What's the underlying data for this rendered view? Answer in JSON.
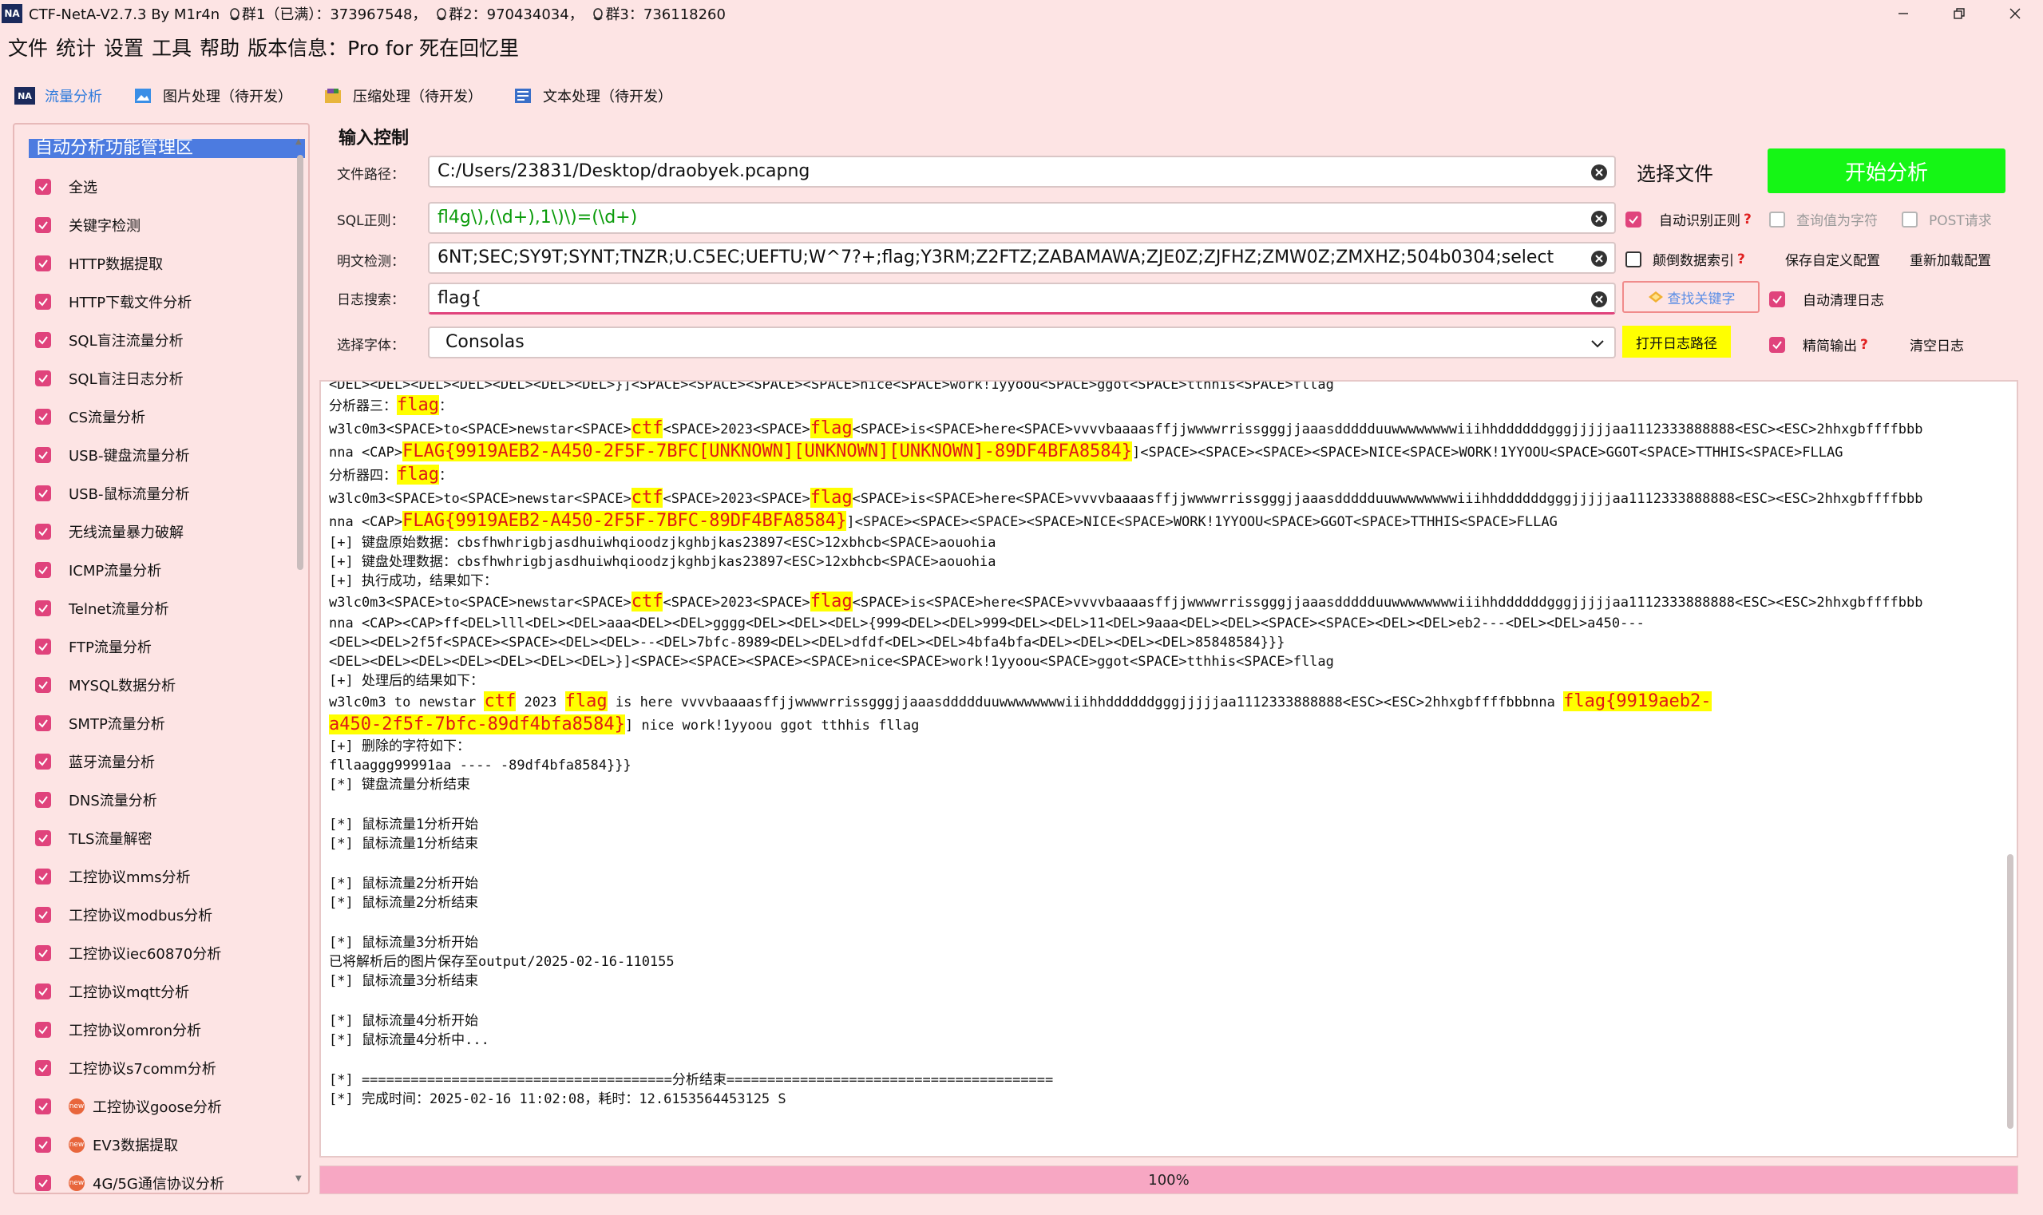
{
  "window": {
    "title_prefix": "CTF-NetA-V2.7.3 By M1r4n",
    "group1": "群1（已满）：373967548，",
    "group2": "群2：970434034，",
    "group3": "群3：736118260",
    "logo": "NA"
  },
  "menu": [
    "文件",
    "统计",
    "设置",
    "工具",
    "帮助",
    "版本信息：",
    "Pro for 死在回忆里"
  ],
  "tabs": [
    {
      "label": "流量分析",
      "icon": "na-logo-icon",
      "active": true
    },
    {
      "label": "图片处理（待开发）",
      "icon": "image-icon",
      "active": false
    },
    {
      "label": "压缩处理（待开发）",
      "icon": "archive-icon",
      "active": false
    },
    {
      "label": "文本处理（待开发）",
      "icon": "document-icon",
      "active": false
    }
  ],
  "sidebar": {
    "header": "自动分析功能管理区",
    "items": [
      "全选",
      "关键字检测",
      "HTTP数据提取",
      "HTTP下载文件分析",
      "SQL盲注流量分析",
      "SQL盲注日志分析",
      "CS流量分析",
      "USB-键盘流量分析",
      "USB-鼠标流量分析",
      "无线流量暴力破解",
      "ICMP流量分析",
      "Telnet流量分析",
      "FTP流量分析",
      "MYSQL数据分析",
      "SMTP流量分析",
      "蓝牙流量分析",
      "DNS流量分析",
      "TLS流量解密",
      "工控协议mms分析",
      "工控协议modbus分析",
      "工控协议iec60870分析",
      "工控协议mqtt分析",
      "工控协议omron分析",
      "工控协议s7comm分析",
      "工控协议goose分析",
      "EV3数据提取",
      "4G/5G通信协议分析"
    ],
    "badge_text": "new"
  },
  "input": {
    "section_title": "输入控制",
    "file_path_label": "文件路径：",
    "file_path": "C:/Users/23831/Desktop/draobyek.pcapng",
    "sql_label": "SQL正则：",
    "sql_regex": "fl4g\\),(\\d+),1\\)\\)=(\\d+)",
    "plain_label": "明文检测：",
    "plain_text": "6NT;SEC;SY9T;SYNT;TNZR;U.C5EC;UEFTU;W^7?+;flag;Y3RM;Z2FTZ;ZABAMAWA;ZJE0Z;ZJFHZ;ZMW0Z;ZMXHZ;504b0304;select",
    "log_search_label": "日志搜索：",
    "log_search": "flag{",
    "font_label": "选择字体：",
    "font_value": "Consolas",
    "choose_file": "选择文件",
    "start": "开始分析",
    "auto_regex": "自动识别正则",
    "query_char": "查询值为字符",
    "post_req": "POST请求",
    "reverse_index": "颠倒数据索引",
    "save_config": "保存自定义配置",
    "reload_config": "重新加载配置",
    "find_keyword": "查找关键字",
    "auto_clear_log": "自动清理日志",
    "open_log_path": "打开日志路径",
    "concise_output": "精简输出",
    "clear_log": "清空日志",
    "qmark": "?"
  },
  "log": {
    "l00": "<DEL><DEL><DEL><DEL><DEL><DEL><DEL>}]<SPACE><SPACE><SPACE><SPACE>nice<SPACE>work!1yyoou<SPACE>ggot<SPACE>tthhis<SPACE>fllag",
    "l01_a": "分析器三：",
    "l01_b": "flag",
    "l01_c": "：",
    "l02_a": "w3lc0m3<SPACE>to<SPACE>newstar<SPACE>",
    "l02_b": "ctf",
    "l02_c": "<SPACE>2023<SPACE>",
    "l02_d": "flag",
    "l02_e": "<SPACE>is<SPACE>here<SPACE>vvvvbaaaasffjjwwwwrrissgggjjaaasddddduuwwwwwwwwiiihhddddddgggjjjjjaa1112333888888<ESC><ESC>2hhxgbffffbbb",
    "l03_a": "nna <CAP>",
    "l03_b": "FLAG{9919AEB2-A450-2F5F-7BFC[UNKNOWN][UNKNOWN][UNKNOWN]-89DF4BFA8584}",
    "l03_c": "]<SPACE><SPACE><SPACE><SPACE>NICE<SPACE>WORK!1YYOOU<SPACE>GGOT<SPACE>TTHHIS<SPACE>FLLAG",
    "l04_a": "分析器四：",
    "l04_b": "flag",
    "l04_c": "：",
    "l05_a": "w3lc0m3<SPACE>to<SPACE>newstar<SPACE>",
    "l05_b": "ctf",
    "l05_c": "<SPACE>2023<SPACE>",
    "l05_d": "flag",
    "l05_e": "<SPACE>is<SPACE>here<SPACE>vvvvbaaaasffjjwwwwrrissgggjjaaasddddduuwwwwwwwwiiihhddddddgggjjjjjaa1112333888888<ESC><ESC>2hhxgbffffbbb",
    "l06_a": "nna <CAP>",
    "l06_b": "FLAG{9919AEB2-A450-2F5F-7BFC-89DF4BFA8584}",
    "l06_c": "]<SPACE><SPACE><SPACE><SPACE>NICE<SPACE>WORK!1YYOOU<SPACE>GGOT<SPACE>TTHHIS<SPACE>FLLAG",
    "l07": "[+] 键盘原始数据：cbsfhwhrigbjasdhuiwhqioodzjkghbjkas23897<ESC>12xbhcb<SPACE>aouohia",
    "l08": "[+] 键盘处理数据：cbsfhwhrigbjasdhuiwhqioodzjkghbjkas23897<ESC>12xbhcb<SPACE>aouohia",
    "l09": "[+] 执行成功，结果如下：",
    "l10_a": "w3lc0m3<SPACE>to<SPACE>newstar<SPACE>",
    "l10_b": "ctf",
    "l10_c": "<SPACE>2023<SPACE>",
    "l10_d": "flag",
    "l10_e": "<SPACE>is<SPACE>here<SPACE>vvvvbaaaasffjjwwwwrrissgggjjaaasddddduuwwwwwwwwiiihhddddddgggjjjjjaa1112333888888<ESC><ESC>2hhxgbffffbbb",
    "l11": "nna <CAP><CAP>ff<DEL>lll<DEL><DEL>aaa<DEL><DEL>gggg<DEL><DEL><DEL>{999<DEL><DEL>999<DEL><DEL>11<DEL>9aaa<DEL><DEL><SPACE><SPACE><DEL><DEL>eb2---<DEL><DEL>a450---",
    "l12": "<DEL><DEL>2f5f<SPACE><SPACE><DEL><DEL>--<DEL>7bfc-8989<DEL><DEL>dfdf<DEL><DEL>4bfa4bfa<DEL><DEL><DEL><DEL>85848584}}}",
    "l13": "<DEL><DEL><DEL><DEL><DEL><DEL><DEL>}]<SPACE><SPACE><SPACE><SPACE>nice<SPACE>work!1yyoou<SPACE>ggot<SPACE>tthhis<SPACE>fllag",
    "l14": "[+] 处理后的结果如下：",
    "l15_a": "w3lc0m3 to newstar ",
    "l15_b": "ctf",
    "l15_c": " 2023 ",
    "l15_d": "flag",
    "l15_e": " is here vvvvbaaaasffjjwwwwrrissgggjjaaasddddduuwwwwwwwwiiihhddddddgggjjjjjaa1112333888888<ESC><ESC>2hhxgbffffbbbnna ",
    "l15_f": "flag{9919aeb2-",
    "l16_a": "a450-2f5f-7bfc-89df4bfa8584}",
    "l16_b": "] nice work!1yyoou ggot tthhis fllag",
    "l17": "[+] 删除的字符如下：",
    "l18": "fllaaggg99991aa ---- -89df4bfa8584}}}",
    "l19": "[*] 键盘流量分析结束",
    "l20": "[*] 鼠标流量1分析开始",
    "l21": "[*] 鼠标流量1分析结束",
    "l22": "[*] 鼠标流量2分析开始",
    "l23": "[*] 鼠标流量2分析结束",
    "l24": "[*] 鼠标流量3分析开始",
    "l25": "已将解析后的图片保存至output/2025-02-16-110155",
    "l26": "[*] 鼠标流量3分析结束",
    "l27": "[*] 鼠标流量4分析开始",
    "l28": "[*] 鼠标流量4分析中...",
    "l29": "[*] ======================================分析结束========================================",
    "l30": "[*] 完成时间：2025-02-16 11:02:08，耗时：12.6153564453125 S"
  },
  "progress": {
    "value": 1.0,
    "label": "100%"
  },
  "colors": {
    "background": "#fde4e4",
    "accent": "#e0437c",
    "start_button": "#15f615",
    "highlight": "#ffff00",
    "flag_text": "#e01818",
    "progress": "#f7a7c3"
  }
}
